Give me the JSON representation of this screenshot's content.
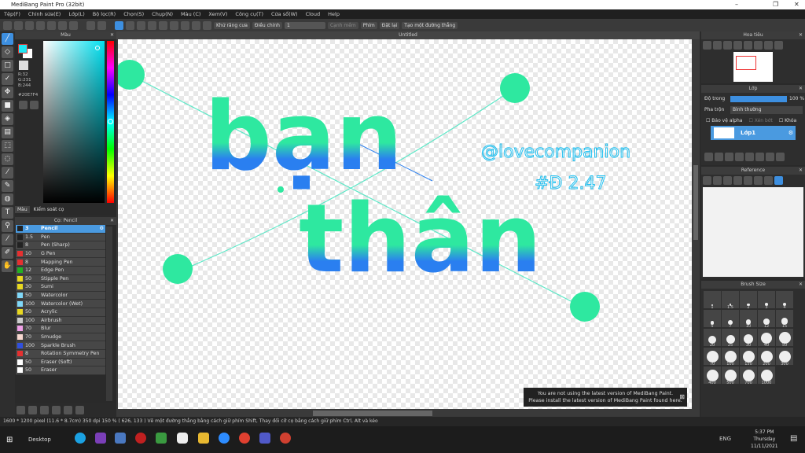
{
  "app": {
    "title": "MediBang Paint Pro (32bit)"
  },
  "menu": [
    "Tệp(F)",
    "Chỉnh sửa(E)",
    "Lớp(L)",
    "Bộ lọc(R)",
    "Chọn(S)",
    "Chụp(N)",
    "Màu (C)",
    "Xem(V)",
    "Công cụ(T)",
    "Cửa sổ(W)",
    "Cloud",
    "Help"
  ],
  "toolbar": {
    "antialias": "Khử răng cưa",
    "adjust_label": "Điều chỉnh",
    "adjust_value": "1",
    "smooth": "Cạnh mềm",
    "keys": "Phím",
    "reset": "Đặt lại",
    "straight_line": "Tạo một đường thẳng"
  },
  "color_panel": {
    "title": "Màu",
    "r": "R:32",
    "g": "G:231",
    "b": "B:244",
    "hex": "#20E7F4",
    "tab_color": "Màu",
    "tab_brush_control": "Kiểm soát cọ",
    "accent": "#20E7F4"
  },
  "brush_panel": {
    "title": "Cọ: Pencil",
    "items": [
      {
        "size": "3",
        "name": "Pencil",
        "color": "#222222",
        "selected": true
      },
      {
        "size": "1.5",
        "name": "Pen",
        "color": "#222222"
      },
      {
        "size": "8",
        "name": "Pen (Sharp)",
        "color": "#222222"
      },
      {
        "size": "10",
        "name": "G Pen",
        "color": "#e53030"
      },
      {
        "size": "8",
        "name": "Mapping Pen",
        "color": "#e53030"
      },
      {
        "size": "12",
        "name": "Edge Pen",
        "color": "#22b022"
      },
      {
        "size": "50",
        "name": "Stipple Pen",
        "color": "#e8d820"
      },
      {
        "size": "30",
        "name": "Sumi",
        "color": "#e8d820"
      },
      {
        "size": "50",
        "name": "Watercolor",
        "color": "#80d8f8"
      },
      {
        "size": "100",
        "name": "Watercolor (Wet)",
        "color": "#80d8f8"
      },
      {
        "size": "50",
        "name": "Acrylic",
        "color": "#e8d820"
      },
      {
        "size": "100",
        "name": "Airbrush",
        "color": "#cccccc"
      },
      {
        "size": "70",
        "name": "Blur",
        "color": "#f0a0e8"
      },
      {
        "size": "70",
        "name": "Smudge",
        "color": "#f8d8d0"
      },
      {
        "size": "100",
        "name": "Sparkle Brush",
        "color": "#3050e0"
      },
      {
        "size": "8",
        "name": "Rotation Symmetry Pen",
        "color": "#e53030"
      },
      {
        "size": "50",
        "name": "Eraser (Soft)",
        "color": "#ffffff"
      },
      {
        "size": "50",
        "name": "Eraser",
        "color": "#ffffff"
      }
    ]
  },
  "document": {
    "tab": "Untitled",
    "art_line1": "bạn",
    "art_line2": "thân",
    "handwriting1": "@lovecompanion",
    "handwriting2": "#Đ 2.47"
  },
  "navigator": {
    "title": "Hoa tiêu"
  },
  "layer": {
    "title": "Lớp",
    "opacity_label": "Độ trong",
    "opacity_value": "100 %",
    "opacity": 100,
    "blend_label": "Pha trộn",
    "blend_value": "Bình thường",
    "protect_alpha": "Bảo vệ alpha",
    "clipping": "Xén bớt",
    "lock": "Khóa",
    "layer_name": "Lớp1"
  },
  "reference": {
    "title": "Reference"
  },
  "brush_size": {
    "title": "Brush Size",
    "sizes": [
      "1",
      "1.5",
      "2",
      "3",
      "4",
      "5",
      "7",
      "10",
      "12",
      "15",
      "20",
      "25",
      "30",
      "40",
      "50",
      "70",
      "100",
      "150",
      "200",
      "300",
      "400",
      "500",
      "700",
      "1000"
    ]
  },
  "notice": {
    "line1": "You are not using the latest version of MediBang Paint.",
    "line2": "Please install the latest version of MediBang Paint found here."
  },
  "status": {
    "text": "1600 * 1200 pixel   (11.6 * 8.7cm)   350 dpi   150 %   ( 626, 133 )   Vẽ một đường thẳng bằng cách giữ phím Shift, Thay đổi cỡ cọ bằng cách giữ phím Ctrl, Alt và kéo"
  },
  "taskbar": {
    "desktop": "Desktop",
    "lang": "ENG",
    "time": "5:37 PM",
    "day": "Thursday",
    "date": "11/11/2021"
  }
}
